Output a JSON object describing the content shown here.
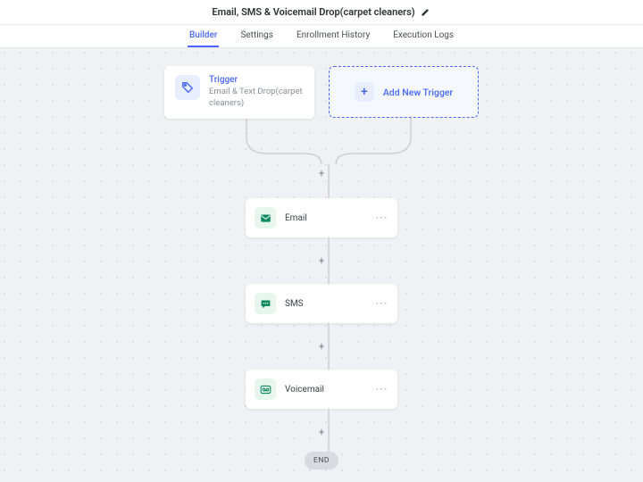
{
  "header": {
    "title": "Email, SMS & Voicemail  Drop(carpet cleaners)"
  },
  "tabs": [
    {
      "label": "Builder",
      "active": true
    },
    {
      "label": "Settings",
      "active": false
    },
    {
      "label": "Enrollment History",
      "active": false
    },
    {
      "label": "Execution Logs",
      "active": false
    }
  ],
  "trigger": {
    "title": "Trigger",
    "subtitle": "Email & Text Drop(carpet cleaners)"
  },
  "add_trigger_label": "Add New Trigger",
  "actions": [
    {
      "label": "Email",
      "icon": "email"
    },
    {
      "label": "SMS",
      "icon": "sms"
    },
    {
      "label": "Voicemail",
      "icon": "voicemail"
    }
  ],
  "end_label": "END",
  "colors": {
    "blue": "#4a68ff",
    "teal": "#0b8a5f"
  }
}
